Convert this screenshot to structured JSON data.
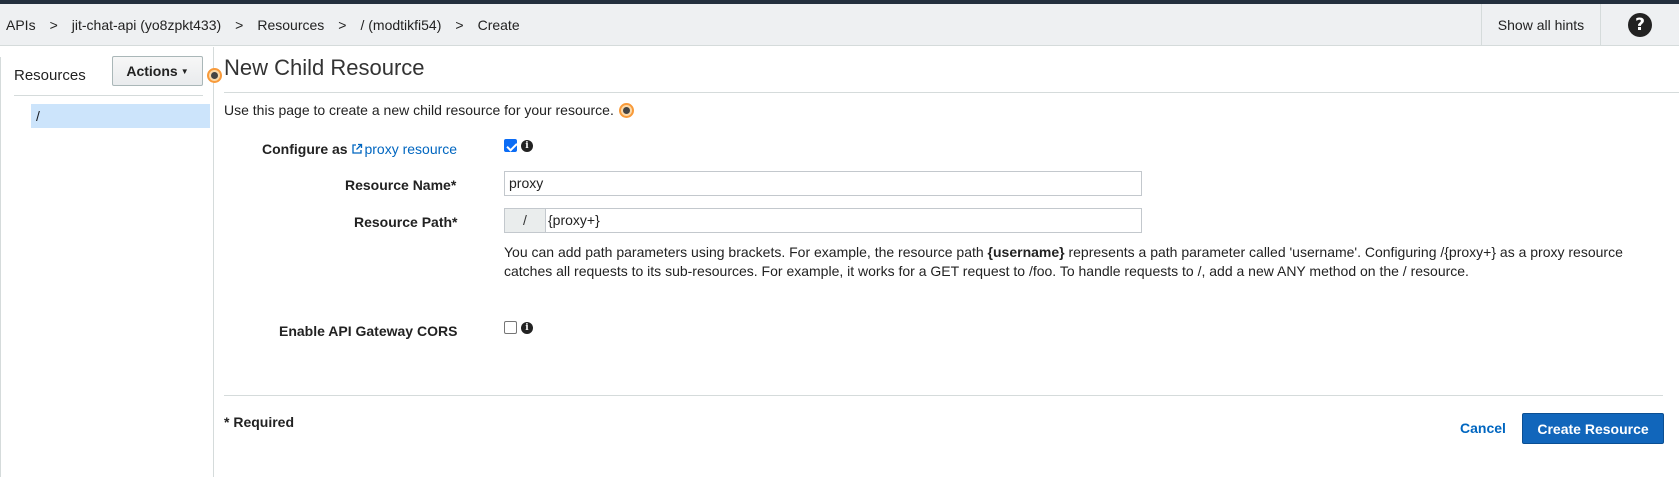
{
  "breadcrumb": [
    "APIs",
    "jit-chat-api (yo8zpkt433)",
    "Resources",
    "/ (modtikfi54)",
    "Create"
  ],
  "breadcrumb_separator": ">",
  "header": {
    "hints_label": "Show all hints",
    "help_icon": "?"
  },
  "sidebar": {
    "title": "Resources",
    "actions_label": "Actions",
    "tree_root": "/"
  },
  "main": {
    "title": "New Child Resource",
    "intro": "Use this page to create a new child resource for your resource.",
    "proxy": {
      "label": "Configure as",
      "link_text": "proxy resource",
      "checked": true
    },
    "resource_name": {
      "label": "Resource Name*",
      "value": "proxy"
    },
    "resource_path": {
      "label": "Resource Path*",
      "prefix": "/",
      "value": "{proxy+}",
      "help_pre": "You can add path parameters using brackets. For example, the resource path ",
      "help_bold": "{username}",
      "help_post": " represents a path parameter called 'username'. Configuring /{proxy+} as a proxy resource catches all requests to its sub-resources. For example, it works for a GET request to /foo. To handle requests to /, add a new ANY method on the / resource."
    },
    "cors": {
      "label": "Enable API Gateway CORS",
      "checked": false
    },
    "footer": {
      "required_note": "* Required",
      "cancel_label": "Cancel",
      "create_label": "Create Resource"
    }
  },
  "colors": {
    "accent": "#1166bb",
    "link": "#0066c0",
    "hint": "#f89a3a",
    "selection": "#cce4fb"
  },
  "icons": [
    "help-icon",
    "caret-down-icon",
    "hint-icon",
    "external-link-icon",
    "info-icon",
    "checkbox-icon"
  ]
}
